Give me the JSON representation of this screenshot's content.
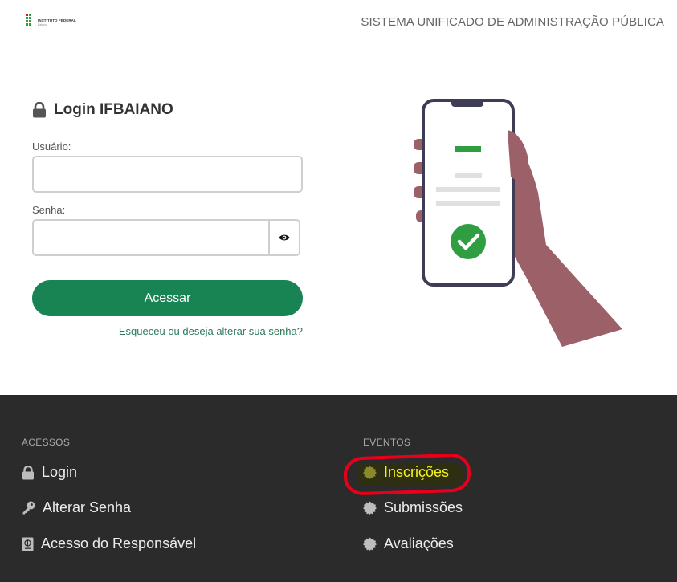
{
  "header": {
    "logo_text": "INSTITUTO FEDERAL",
    "logo_sub": "Baiano",
    "system_title": "SISTEMA UNIFICADO DE ADMINISTRAÇÃO PÚBLICA"
  },
  "login": {
    "title": "Login IFBAIANO",
    "user_label": "Usuário:",
    "user_value": "",
    "pass_label": "Senha:",
    "pass_value": "",
    "submit_label": "Acessar",
    "forgot_label": "Esqueceu ou deseja alterar sua senha?"
  },
  "footer": {
    "acessos": {
      "title": "ACESSOS",
      "items": [
        {
          "label": "Login",
          "icon": "lock-icon"
        },
        {
          "label": "Alterar Senha",
          "icon": "key-icon"
        },
        {
          "label": "Acesso do Responsável",
          "icon": "passport-icon"
        }
      ]
    },
    "eventos": {
      "title": "EVENTOS",
      "items": [
        {
          "label": "Inscrições",
          "icon": "certificate-icon"
        },
        {
          "label": "Submissões",
          "icon": "certificate-icon"
        },
        {
          "label": "Avaliações",
          "icon": "certificate-icon"
        }
      ]
    }
  },
  "colors": {
    "accent": "#188454",
    "footer_bg": "#2b2b2b",
    "highlight_text": "#f2f21a",
    "annotation": "#e8001b"
  }
}
